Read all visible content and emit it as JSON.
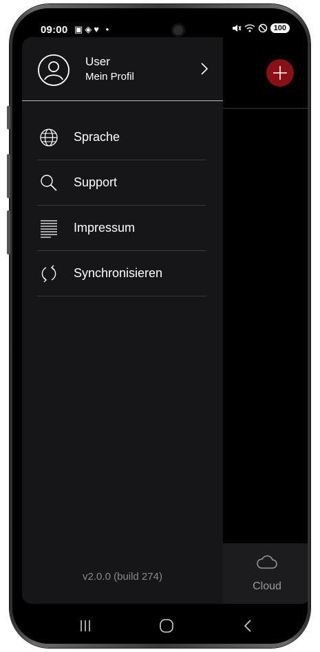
{
  "statusbar": {
    "time": "09:00",
    "left_icons": "▣◈♥ •",
    "right_icons": "🔇 ◇ ⊘",
    "battery": "100"
  },
  "drawer": {
    "profile": {
      "name": "User",
      "subtitle": "Mein Profil"
    },
    "items": [
      {
        "label": "Sprache",
        "icon": "globe-icon"
      },
      {
        "label": "Support",
        "icon": "search-icon"
      },
      {
        "label": "Impressum",
        "icon": "document-lines-icon"
      },
      {
        "label": "Synchronisieren",
        "icon": "sync-icon"
      }
    ],
    "version": "v2.0.0 (build 274)"
  },
  "background": {
    "cloud_label": "Cloud",
    "accent_color": "#8a1018"
  }
}
